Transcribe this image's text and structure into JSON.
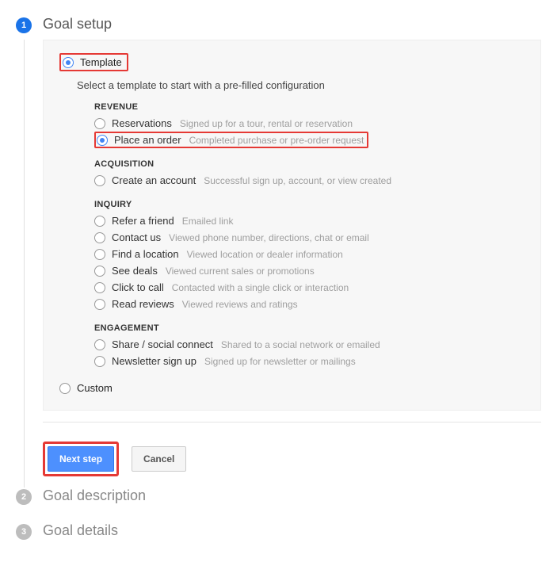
{
  "steps": {
    "s1": {
      "num": "1",
      "title": "Goal setup"
    },
    "s2": {
      "num": "2",
      "title": "Goal description"
    },
    "s3": {
      "num": "3",
      "title": "Goal details"
    }
  },
  "topRadio": {
    "template": "Template",
    "custom": "Custom"
  },
  "subtext": "Select a template to start with a pre-filled configuration",
  "groups": {
    "revenue": {
      "header": "REVENUE",
      "items": [
        {
          "label": "Reservations",
          "desc": "Signed up for a tour, rental or reservation"
        },
        {
          "label": "Place an order",
          "desc": "Completed purchase or pre-order request"
        }
      ]
    },
    "acquisition": {
      "header": "ACQUISITION",
      "items": [
        {
          "label": "Create an account",
          "desc": "Successful sign up, account, or view created"
        }
      ]
    },
    "inquiry": {
      "header": "INQUIRY",
      "items": [
        {
          "label": "Refer a friend",
          "desc": "Emailed link"
        },
        {
          "label": "Contact us",
          "desc": "Viewed phone number, directions, chat or email"
        },
        {
          "label": "Find a location",
          "desc": "Viewed location or dealer information"
        },
        {
          "label": "See deals",
          "desc": "Viewed current sales or promotions"
        },
        {
          "label": "Click to call",
          "desc": "Contacted with a single click or interaction"
        },
        {
          "label": "Read reviews",
          "desc": "Viewed reviews and ratings"
        }
      ]
    },
    "engagement": {
      "header": "ENGAGEMENT",
      "items": [
        {
          "label": "Share / social connect",
          "desc": "Shared to a social network or emailed"
        },
        {
          "label": "Newsletter sign up",
          "desc": "Signed up for newsletter or mailings"
        }
      ]
    }
  },
  "buttons": {
    "next": "Next step",
    "cancel": "Cancel"
  }
}
